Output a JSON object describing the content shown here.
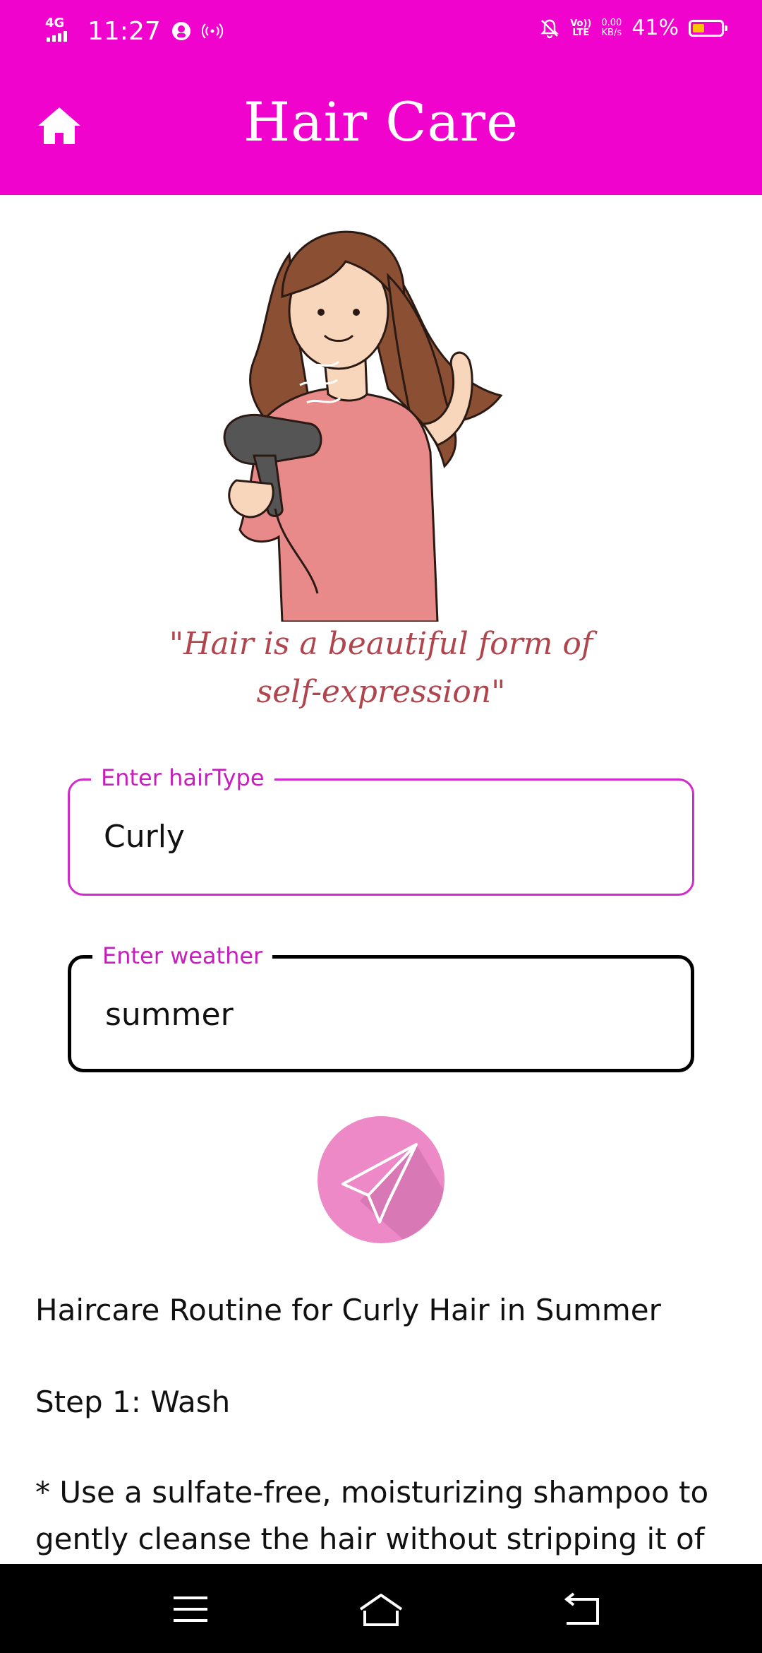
{
  "status_bar": {
    "network": "4G",
    "time": "11:27",
    "volte_top": "Vo))",
    "volte_bottom": "LTE",
    "speed_value": "0.00",
    "speed_unit": "KB/s",
    "battery_percent": "41%",
    "battery_level": 0.41,
    "battery_color": "#f9c400",
    "icons": [
      "signal-icon",
      "hotspot-icon",
      "broadcast-icon",
      "mute-bell-icon",
      "battery-icon"
    ]
  },
  "app_bar": {
    "title": "Hair Care",
    "home_icon": "home-icon",
    "background": "#f003cc"
  },
  "hero": {
    "image": "woman-with-hair-dryer-illustration",
    "quote_line1": "\"Hair is a beautiful form of",
    "quote_line2": "self-expression\""
  },
  "form": {
    "hair_type": {
      "label": "Enter hairType",
      "value": "Curly"
    },
    "weather": {
      "label": "Enter weather",
      "value": "summer"
    },
    "send_icon": "paper-plane-icon"
  },
  "result": {
    "heading": "Haircare Routine for Curly Hair in Summer",
    "step1_title": "Step 1: Wash",
    "step1_line1": "* Use a sulfate-free, moisturizing shampoo to",
    "step1_line2": "gently cleanse the hair without stripping it of"
  },
  "nav_bar": {
    "icons": [
      "menu-icon",
      "home-nav-icon",
      "back-icon"
    ]
  }
}
